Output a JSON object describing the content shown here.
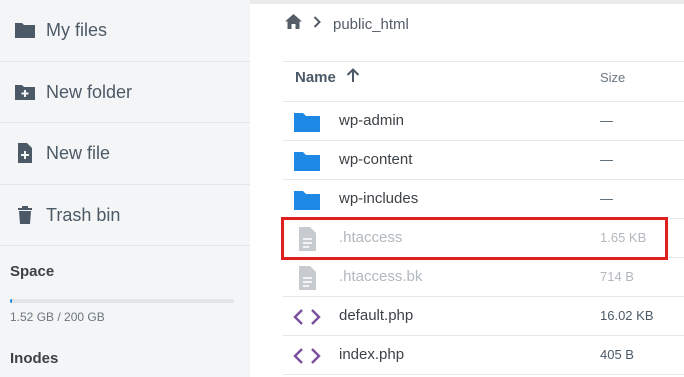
{
  "sidebar": {
    "items": [
      {
        "label": "My files",
        "icon": "folder-icon"
      },
      {
        "label": "New folder",
        "icon": "folder-plus-icon"
      },
      {
        "label": "New file",
        "icon": "file-plus-icon"
      },
      {
        "label": "Trash bin",
        "icon": "trash-icon"
      }
    ],
    "space": {
      "title": "Space",
      "usage_text": "1.52 GB / 200 GB",
      "used_fraction": 0.0076
    },
    "inodes": {
      "title": "Inodes"
    }
  },
  "breadcrumb": {
    "home_icon": "home-icon",
    "separator_icon": "chevron-right-icon",
    "current": "public_html"
  },
  "table": {
    "headers": {
      "name": "Name",
      "size": "Size"
    },
    "sort": {
      "column": "name",
      "direction": "ascending",
      "icon": "arrow-up-icon"
    },
    "rows": [
      {
        "name": "wp-admin",
        "size": "—",
        "type": "folder"
      },
      {
        "name": "wp-content",
        "size": "—",
        "type": "folder"
      },
      {
        "name": "wp-includes",
        "size": "—",
        "type": "folder"
      },
      {
        "name": ".htaccess",
        "size": "1.65 KB",
        "type": "file",
        "hidden": true,
        "highlighted": true
      },
      {
        "name": ".htaccess.bk",
        "size": "714 B",
        "type": "file",
        "hidden": true
      },
      {
        "name": "default.php",
        "size": "16.02 KB",
        "type": "code"
      },
      {
        "name": "index.php",
        "size": "405 B",
        "type": "code"
      }
    ]
  },
  "colors": {
    "folder": "#1e88e5",
    "code": "#7b4f9e",
    "hidden_file": "#c7cbcf",
    "sidebar_icon": "#4c5a67",
    "highlight": "#e01f1f"
  }
}
